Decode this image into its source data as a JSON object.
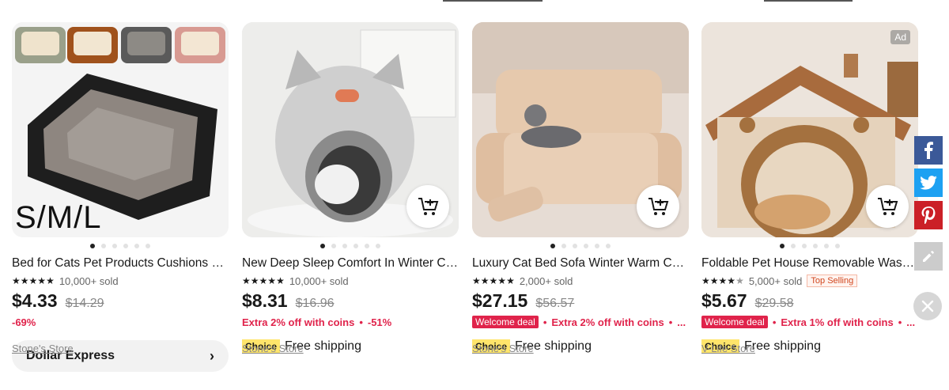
{
  "products": [
    {
      "title": "Bed for Cats Pet Products Cushions Kennel Accessories",
      "rating": "5",
      "sold": "10,000+ sold",
      "price": "$4.33",
      "original_price": "$14.29",
      "discount": "-69%",
      "image_overlay": "S/M/L",
      "express_label": "Dollar Express",
      "store": "Stone's Store",
      "image_index": 1,
      "image_count": 6
    },
    {
      "title": "New Deep Sleep Comfort In Winter Cat Bed Little Mat",
      "rating": "5",
      "sold": "10,000+ sold",
      "price": "$8.31",
      "original_price": "$16.96",
      "promo": "Extra 2% off with coins",
      "discount": "-51%",
      "choice": "Choice",
      "shipping": "Free shipping",
      "store": "Stone's Store",
      "image_index": 1,
      "image_count": 6
    },
    {
      "title": "Luxury Cat Bed Sofa Winter Warm Cat Nest Pet Bed",
      "rating": "5",
      "sold": "2,000+ sold",
      "price": "$27.15",
      "original_price": "$56.57",
      "welcome": "Welcome deal",
      "promo": "Extra 2% off with coins",
      "more": "...",
      "choice": "Choice",
      "shipping": "Free shipping",
      "store": "Stone's Store",
      "image_index": 1,
      "image_count": 6
    },
    {
      "title": "Foldable Pet House Removable Washable Cat Bed",
      "rating": "4.5",
      "sold": "5,000+ sold",
      "top_badge": "Top Selling",
      "price": "$5.67",
      "original_price": "$29.58",
      "welcome": "Welcome deal",
      "promo": "Extra 1% off with coins",
      "more": "...",
      "choice": "Choice",
      "shipping": "Free shipping",
      "store": "V-Life Store",
      "ad": "Ad",
      "image_index": 1,
      "image_count": 6
    }
  ],
  "share": {
    "icons": [
      "facebook-icon",
      "twitter-icon",
      "pinterest-icon",
      "edit-icon",
      "close-icon"
    ],
    "colors": {
      "facebook": "#3b5998",
      "twitter": "#1da1f2",
      "pinterest": "#cb2027",
      "edit": "#cccccc"
    }
  },
  "colors": {
    "accent_red": "#e0234b",
    "choice_yellow": "#ffe56b"
  }
}
